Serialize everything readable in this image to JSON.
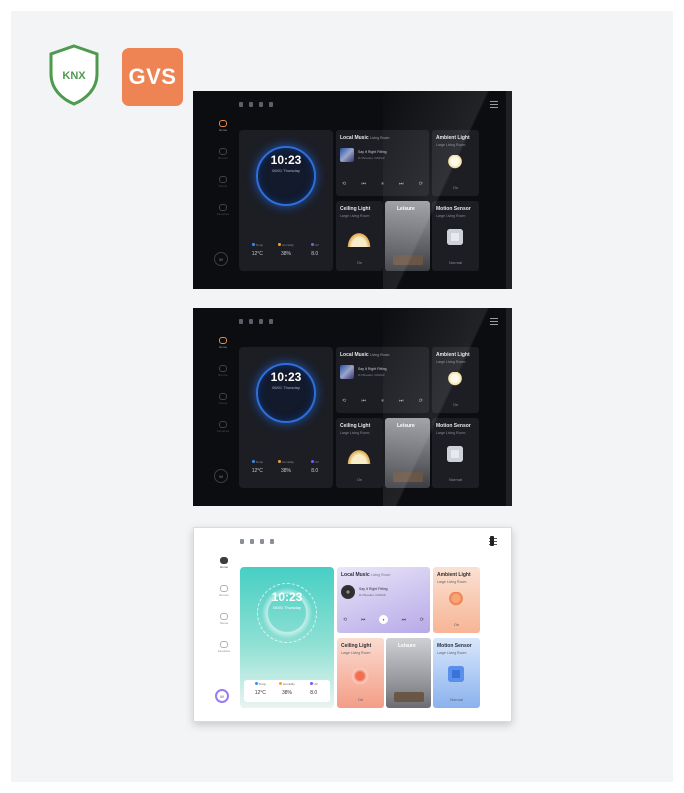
{
  "logos": {
    "knx": "KNX",
    "gvs": "GVS"
  },
  "colors": {
    "gvs_orange": "#ee8354",
    "knx_green": "#4e9a4e",
    "dark_clock_ring": "#2f6fd8",
    "light_clock_bg": "#47cfc4"
  },
  "panels": [
    {
      "theme": "dark",
      "nav": [
        "Home",
        "Rooms",
        "Scene",
        "Favorites"
      ],
      "avatar": "W",
      "clock": {
        "time": "10:23",
        "date": "06/01 Thursday"
      },
      "stats": [
        {
          "label": "Temp",
          "value": "12°C"
        },
        {
          "label": "Humidity",
          "value": "38%"
        },
        {
          "label": "UV",
          "value": "8.0"
        }
      ],
      "music": {
        "title": "Local Music",
        "room": "Living Room",
        "song": "Say It Right Fitting",
        "artist": "DJ Breaker, DARAZ"
      },
      "ambient": {
        "title": "Ambient Light",
        "room": "Large Living Room",
        "state": "On"
      },
      "ceiling": {
        "title": "Ceiling Light",
        "room": "Large Living Room",
        "state": "On"
      },
      "leisure": {
        "title": "Leisure"
      },
      "motion": {
        "title": "Motion Sensor",
        "room": "Large Living Room",
        "state": "Normal"
      }
    },
    {
      "theme": "dark",
      "nav": [
        "Home",
        "Rooms",
        "Scene",
        "Favorites"
      ],
      "avatar": "W",
      "clock": {
        "time": "10:23",
        "date": "06/01 Thursday"
      },
      "stats": [
        {
          "label": "Temp",
          "value": "12°C"
        },
        {
          "label": "Humidity",
          "value": "38%"
        },
        {
          "label": "UV",
          "value": "8.0"
        }
      ],
      "music": {
        "title": "Local Music",
        "room": "Living Room",
        "song": "Say It Right Fitting",
        "artist": "DJ Breaker, DARAZ"
      },
      "ambient": {
        "title": "Ambient Light",
        "room": "Large Living Room",
        "state": "On"
      },
      "ceiling": {
        "title": "Ceiling Light",
        "room": "Large Living Room",
        "state": "On"
      },
      "leisure": {
        "title": "Leisure"
      },
      "motion": {
        "title": "Motion Sensor",
        "room": "Large Living Room",
        "state": "Normal"
      }
    },
    {
      "theme": "light",
      "nav": [
        "Home",
        "Rooms",
        "Scene",
        "Favorites"
      ],
      "avatar": "W",
      "clock": {
        "time": "10:23",
        "date": "06/01 Thursday"
      },
      "stats": [
        {
          "label": "Temp",
          "value": "12°C"
        },
        {
          "label": "Humidity",
          "value": "38%"
        },
        {
          "label": "UV",
          "value": "8.0"
        }
      ],
      "music": {
        "title": "Local Music",
        "room": "Living Room",
        "song": "Say It Right Fitting",
        "artist": "DJ Breaker, DARAZ"
      },
      "ambient": {
        "title": "Ambient Light",
        "room": "Large Living Room",
        "state": "On"
      },
      "ceiling": {
        "title": "Ceiling Light",
        "room": "Large Living Room",
        "state": "On"
      },
      "leisure": {
        "title": "Leisure"
      },
      "motion": {
        "title": "Motion Sensor",
        "room": "Large Living Room",
        "state": "Normal"
      }
    }
  ]
}
